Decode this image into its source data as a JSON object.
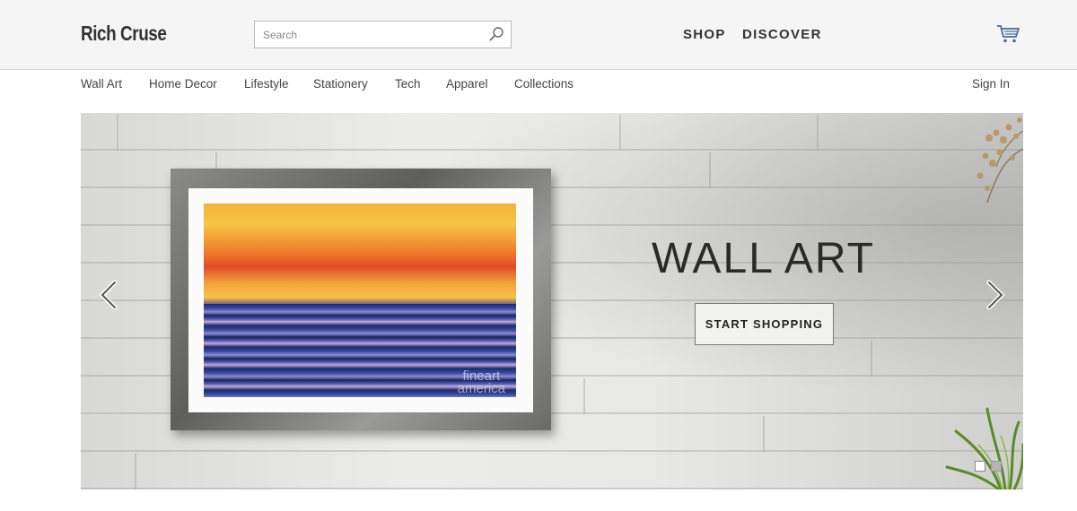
{
  "header": {
    "logo": "Rich Cruse",
    "search": {
      "placeholder": "Search",
      "value": ""
    },
    "nav": {
      "shop": "SHOP",
      "discover": "DISCOVER"
    }
  },
  "subnav": {
    "items": [
      {
        "label": "Wall Art"
      },
      {
        "label": "Home Decor"
      },
      {
        "label": "Lifestyle"
      },
      {
        "label": "Stationery"
      },
      {
        "label": "Tech"
      },
      {
        "label": "Apparel"
      },
      {
        "label": "Collections"
      }
    ],
    "signin": "Sign In"
  },
  "hero": {
    "title": "WALL ART",
    "cta_label": "START SHOPPING",
    "watermark_line1": "fineart",
    "watermark_line2": "america",
    "slides_total": 2,
    "active_slide": 1
  },
  "icons": {
    "search": "search-icon",
    "cart": "cart-icon",
    "prev": "chevron-left-icon",
    "next": "chevron-right-icon"
  },
  "colors": {
    "header_bg": "#f5f5f5",
    "text_dark": "#333333",
    "hero_wall": "#e6e6e4"
  }
}
